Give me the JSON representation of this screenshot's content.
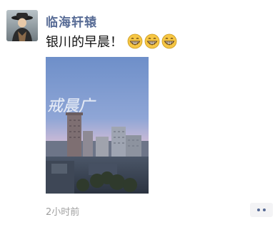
{
  "post": {
    "author": "临海轩辕",
    "text": "银川的早晨！",
    "emojis": [
      "grin-emoji",
      "grin-emoji",
      "grin-emoji"
    ],
    "photo_watermark": "戒晨广",
    "timestamp": "2小时前"
  },
  "colors": {
    "author": "#576b95",
    "text": "#111111",
    "timestamp": "#a0a0a0",
    "more_bg": "#f3f3f5"
  }
}
